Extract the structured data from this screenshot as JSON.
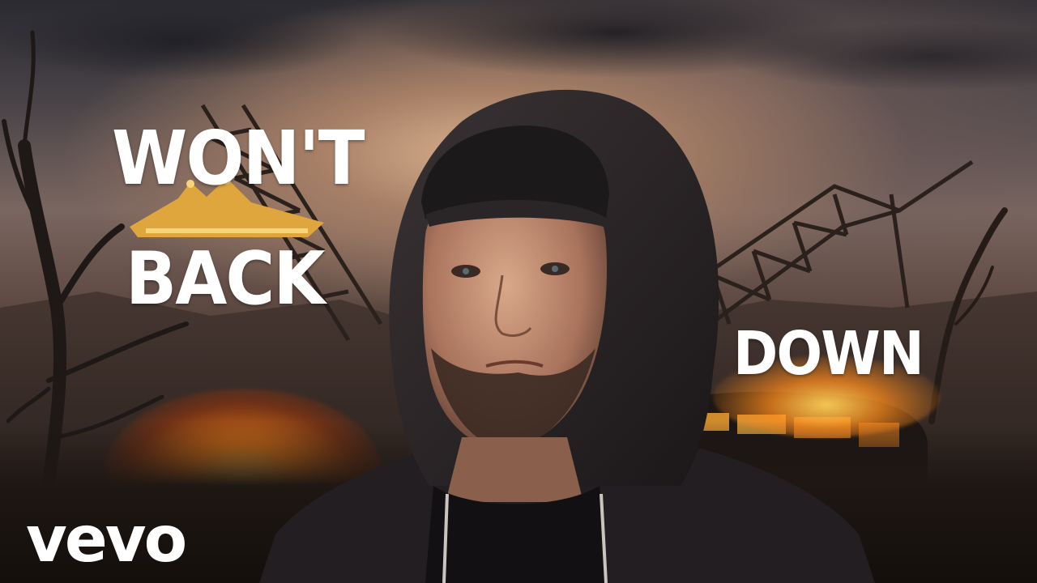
{
  "lyrics": {
    "line1": "WON'T",
    "line2": "BACK",
    "line3": "DOWN"
  },
  "logo": {
    "text": "vevo"
  },
  "scene": {
    "icons": [
      "crown-icon",
      "fire-icon",
      "vevo-logo"
    ],
    "colors": {
      "lyric_text": "#ffffff",
      "fire": "#ff9a2a",
      "sky": "#a77f66",
      "hoodie": "#2a2528"
    }
  }
}
